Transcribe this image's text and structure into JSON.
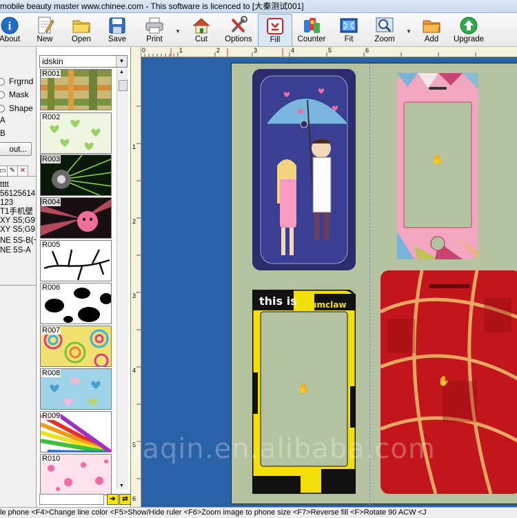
{
  "window": {
    "title": "mobile beauty master www.chinee.com - This software is licenced to [大秦测试001]"
  },
  "toolbar": {
    "about": "About",
    "new": "New",
    "open": "Open",
    "save": "Save",
    "print": "Print",
    "cut": "Cut",
    "options": "Options",
    "fill": "Fill",
    "counter": "Counter",
    "fit": "Fit",
    "zoom": "Zoom",
    "add": "Add",
    "upgrade": "Upgrade"
  },
  "left_panel": {
    "radio_frgrnd": "Frgrnd",
    "radio_mask": "Mask",
    "radio_shape": "Shape",
    "label_a": "A",
    "label_b": "B",
    "about_button": "out...",
    "models": [
      "tttt",
      "56125614",
      "123",
      "T1手机壁",
      "XY S5;G9",
      "XY S5;G9",
      "NE 5S-B(~",
      "NE 5S-A"
    ]
  },
  "library": {
    "selected": "idskin",
    "items": [
      {
        "code": "R001"
      },
      {
        "code": "R002"
      },
      {
        "code": "R003"
      },
      {
        "code": "R004"
      },
      {
        "code": "R005"
      },
      {
        "code": "R006"
      },
      {
        "code": "R007"
      },
      {
        "code": "R008"
      },
      {
        "code": "R009"
      },
      {
        "code": "R010"
      }
    ]
  },
  "rulers": {
    "top": [
      "0",
      "1",
      "2",
      "3",
      "4",
      "5",
      "6"
    ],
    "left": [
      "1",
      "2",
      "3",
      "4",
      "5",
      "6"
    ]
  },
  "sheet": {
    "wrap_text_1": "this is",
    "wrap_text_2": "zumclaw"
  },
  "statusbar": {
    "text": "le phone <F4>Change line color <F5>Show/Hide ruler <F6>Zoom image to phone size <F7>Reverse fill <F>Rotate 90 ACW <J"
  },
  "watermark": "daqin.en.alibaba.com",
  "colors": {
    "canvas": "#2a62a8",
    "sheet": "#b5c2a0",
    "ruler": "#f4f1dc"
  }
}
